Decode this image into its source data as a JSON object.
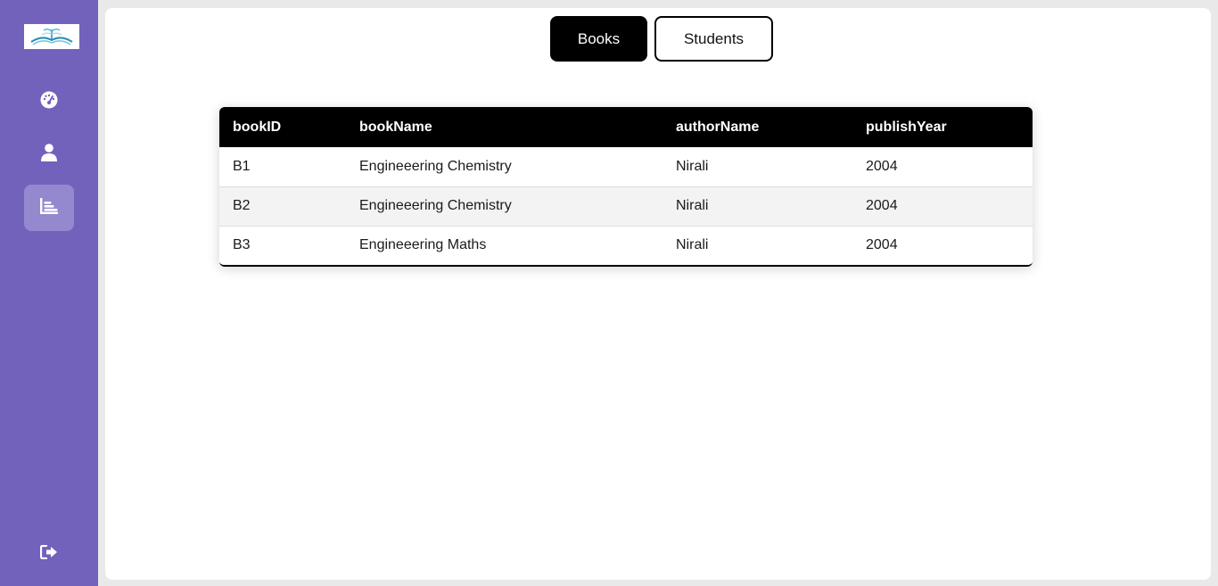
{
  "sidebar": {
    "logo_icon": "open-book-logo",
    "items": [
      {
        "icon": "dashboard-gauge-icon",
        "active": false
      },
      {
        "icon": "user-icon",
        "active": false
      },
      {
        "icon": "bar-chart-icon",
        "active": true
      }
    ],
    "logout_icon": "logout-icon"
  },
  "tabs": [
    {
      "label": "Books",
      "active": true
    },
    {
      "label": "Students",
      "active": false
    }
  ],
  "table": {
    "headers": [
      "bookID",
      "bookName",
      "authorName",
      "publishYear"
    ],
    "rows": [
      [
        "B1",
        "Engineeering Chemistry",
        "Nirali",
        "2004"
      ],
      [
        "B2",
        "Engineeering Chemistry",
        "Nirali",
        "2004"
      ],
      [
        "B3",
        "Engineeering Maths",
        "Nirali",
        "2004"
      ]
    ]
  },
  "colors": {
    "sidebar": "#7262bb",
    "active_nav": "#9488cf",
    "table_header": "#000000",
    "active_tab": "#000000"
  }
}
